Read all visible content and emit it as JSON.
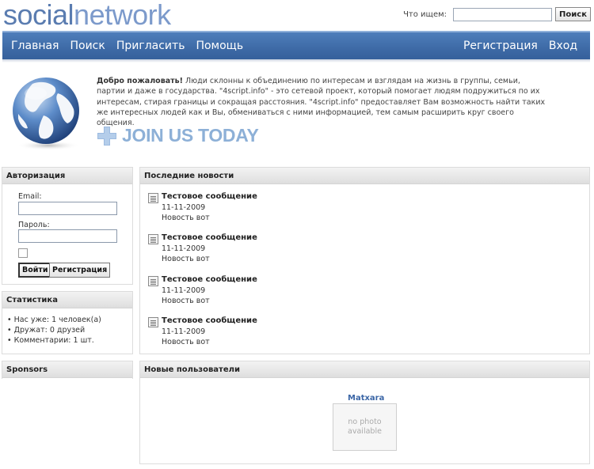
{
  "header": {
    "logo_part1": "social",
    "logo_part2": "network",
    "search_label": "Что ищем:",
    "search_value": "",
    "search_button": "Поиск"
  },
  "nav": {
    "left": [
      "Главная",
      "Поиск",
      "Пригласить",
      "Помощь"
    ],
    "right": [
      "Регистрация",
      "Вход"
    ]
  },
  "intro": {
    "welcome_bold": "Добро пожаловать!",
    "text": " Люди склонны к объединению по интересам и взглядам на жизнь в группы, семьи, партии и даже в государства. \"4script.info\" - это сетевой проект, который помогает людям подружиться по их интересам, стирая границы и сокращая расстояния. \"4script.info\" предоставляет Вам возможность найти таких же интересных людей как и Вы, обмениваться с ними информацией, тем самым расширить круг своего общения.",
    "join_label": "JOIN US TODAY"
  },
  "auth": {
    "title": "Авторизация",
    "email_label": "Email:",
    "email_value": "",
    "password_label": "Пароль:",
    "password_value": "",
    "remember_checked": false,
    "login_button": "Войти",
    "register_button": "Регистрация"
  },
  "stats": {
    "title": "Статистика",
    "items": [
      "Нас уже: 1 человек(а)",
      "Дружат: 0 друзей",
      "Комментарии: 1 шт."
    ]
  },
  "sponsors": {
    "title": "Sponsors"
  },
  "news": {
    "title": "Последние новости",
    "items": [
      {
        "title": "Тестовое сообщение",
        "date": "11-11-2009",
        "body": "Новость вот"
      },
      {
        "title": "Тестовое сообщение",
        "date": "11-11-2009",
        "body": "Новость вот"
      },
      {
        "title": "Тестовое сообщение",
        "date": "11-11-2009",
        "body": "Новость вот"
      },
      {
        "title": "Тестовое сообщение",
        "date": "11-11-2009",
        "body": "Новость вот"
      }
    ]
  },
  "new_users": {
    "title": "Новые пользователи",
    "users": [
      {
        "name": "Matxara",
        "photo_line1": "no photo",
        "photo_line2": "available"
      }
    ]
  },
  "colors": {
    "nav_blue": "#3e6aa6",
    "logo_blue": "#5a7cb0",
    "join_blue": "#8db0d7",
    "link_blue": "#3b66a6"
  }
}
